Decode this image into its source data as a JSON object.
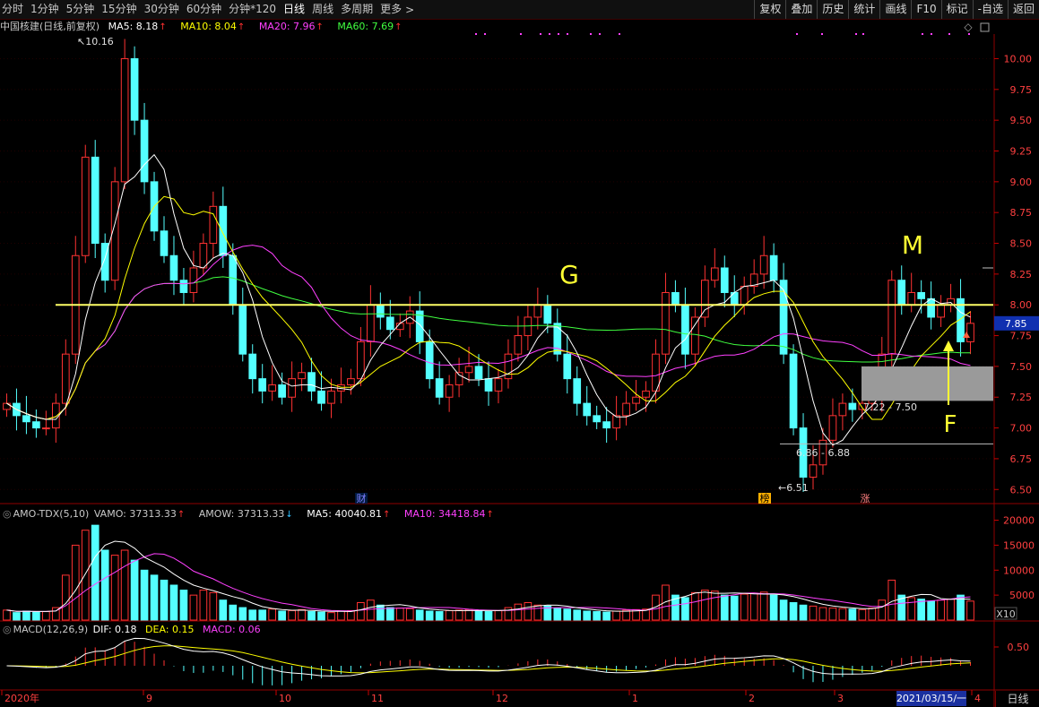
{
  "toolbar": {
    "periods": [
      "分时",
      "1分钟",
      "5分钟",
      "15分钟",
      "30分钟",
      "60分钟",
      "分钟*120",
      "日线",
      "周线",
      "多周期",
      "更多"
    ],
    "active_period": "日线",
    "more_arrow": ">",
    "buttons": [
      "复权",
      "叠加",
      "历史",
      "统计",
      "画线",
      "F10",
      "标记",
      "-自选",
      "返回"
    ]
  },
  "price_info": {
    "title": "中国核建(日线,前复权)",
    "ma5": "MA5: 8.18",
    "ma10": "MA10: 8.04",
    "ma20": "MA20: 7.96",
    "ma60": "MA60: 7.69",
    "colors": {
      "ma5": "#ffffff",
      "ma10": "#ffff00",
      "ma20": "#ff40ff",
      "ma60": "#40ff40"
    }
  },
  "volume_info": {
    "name": "AMO-TDX(5,10)",
    "vamo": "VAMO: 37313.33",
    "amow": "AMOW: 37313.33",
    "ma5": "MA5: 40040.81",
    "ma10": "MA10: 34418.84"
  },
  "macd_info": {
    "name": "MACD(12,26,9)",
    "dif": "DIF: 0.18",
    "dea": "DEA: 0.15",
    "macd": "MACD: 0.06"
  },
  "annotations": {
    "g": "G",
    "m": "M",
    "f": "F",
    "high_label": "10.16",
    "low_label": "6.51",
    "range1": "6.86 - 6.88",
    "range2": "7.22 - 7.50",
    "marker_cai": "财",
    "marker_bang": "榜",
    "marker_zhang": "涨",
    "current_price": "7.85"
  },
  "footer": {
    "months": [
      "2020年",
      "9",
      "10",
      "11",
      "12",
      "1",
      "2",
      "3",
      "4"
    ],
    "date_box": "2021/03/15/一",
    "corner": "日线",
    "x10": "X10"
  },
  "chart_data": [
    {
      "type": "candlestick",
      "title": "中国核建(日线,前复权)",
      "ylim": [
        6.4,
        10.2
      ],
      "y_ticks": [
        6.5,
        6.75,
        7.0,
        7.25,
        7.5,
        7.75,
        8.0,
        8.25,
        8.5,
        8.75,
        9.0,
        9.25,
        9.5,
        9.75,
        10.0
      ],
      "annotated_high": 10.16,
      "annotated_low": 6.51,
      "horizontal_line": 8.0,
      "current_price": 7.85,
      "closes": [
        7.2,
        7.1,
        7.05,
        7.0,
        7.0,
        7.2,
        7.6,
        8.4,
        9.2,
        8.5,
        8.2,
        9.0,
        10.0,
        9.5,
        9.0,
        8.6,
        8.4,
        8.2,
        8.1,
        8.3,
        8.5,
        8.8,
        8.4,
        8.0,
        7.6,
        7.4,
        7.3,
        7.35,
        7.25,
        7.4,
        7.45,
        7.3,
        7.2,
        7.3,
        7.35,
        7.4,
        7.7,
        8.0,
        7.9,
        7.8,
        7.85,
        7.95,
        7.7,
        7.4,
        7.25,
        7.35,
        7.45,
        7.5,
        7.4,
        7.3,
        7.4,
        7.6,
        7.75,
        7.9,
        8.0,
        7.85,
        7.6,
        7.4,
        7.2,
        7.1,
        7.05,
        7.0,
        7.1,
        7.2,
        7.25,
        7.3,
        7.6,
        8.1,
        8.0,
        7.6,
        7.9,
        8.2,
        8.3,
        8.1,
        8.0,
        8.15,
        8.25,
        8.4,
        8.2,
        7.6,
        7.0,
        6.6,
        6.7,
        6.9,
        7.1,
        7.2,
        7.15,
        7.2,
        7.25,
        7.6,
        8.2,
        8.0,
        8.1,
        8.05,
        7.9,
        8.0,
        8.05,
        7.7,
        7.85
      ]
    },
    {
      "type": "bar",
      "title": "AMO-TDX(5,10)",
      "ylim": [
        0,
        21000
      ],
      "y_ticks": [
        5000,
        10000,
        15000,
        20000
      ],
      "values": [
        2000,
        1500,
        1800,
        1600,
        1700,
        2500,
        9000,
        15000,
        18000,
        19000,
        14000,
        13000,
        14000,
        12000,
        10000,
        9000,
        8000,
        7000,
        6000,
        5000,
        6000,
        5500,
        4000,
        3000,
        2500,
        2000,
        2000,
        2200,
        1800,
        1900,
        2100,
        1700,
        1600,
        1500,
        1800,
        1900,
        3500,
        4000,
        3000,
        2500,
        2400,
        2300,
        2000,
        1800,
        1700,
        1900,
        2000,
        2100,
        1800,
        1700,
        1900,
        2500,
        3200,
        3500,
        3000,
        2800,
        2400,
        2200,
        2000,
        1800,
        1700,
        1600,
        1800,
        2000,
        2100,
        2200,
        5000,
        7000,
        5000,
        4500,
        5500,
        6000,
        5800,
        5000,
        4800,
        5200,
        5400,
        5600,
        5000,
        4000,
        3500,
        3000,
        2800,
        2500,
        2400,
        2300,
        2200,
        2100,
        2400,
        4000,
        8000,
        5000,
        4500,
        4200,
        3800,
        4000,
        4200,
        5000,
        3800
      ]
    },
    {
      "type": "line",
      "title": "MACD(12,26,9)",
      "y_ticks": [
        0.5
      ],
      "dif": 0.18,
      "dea": 0.15,
      "macd": 0.06
    }
  ]
}
